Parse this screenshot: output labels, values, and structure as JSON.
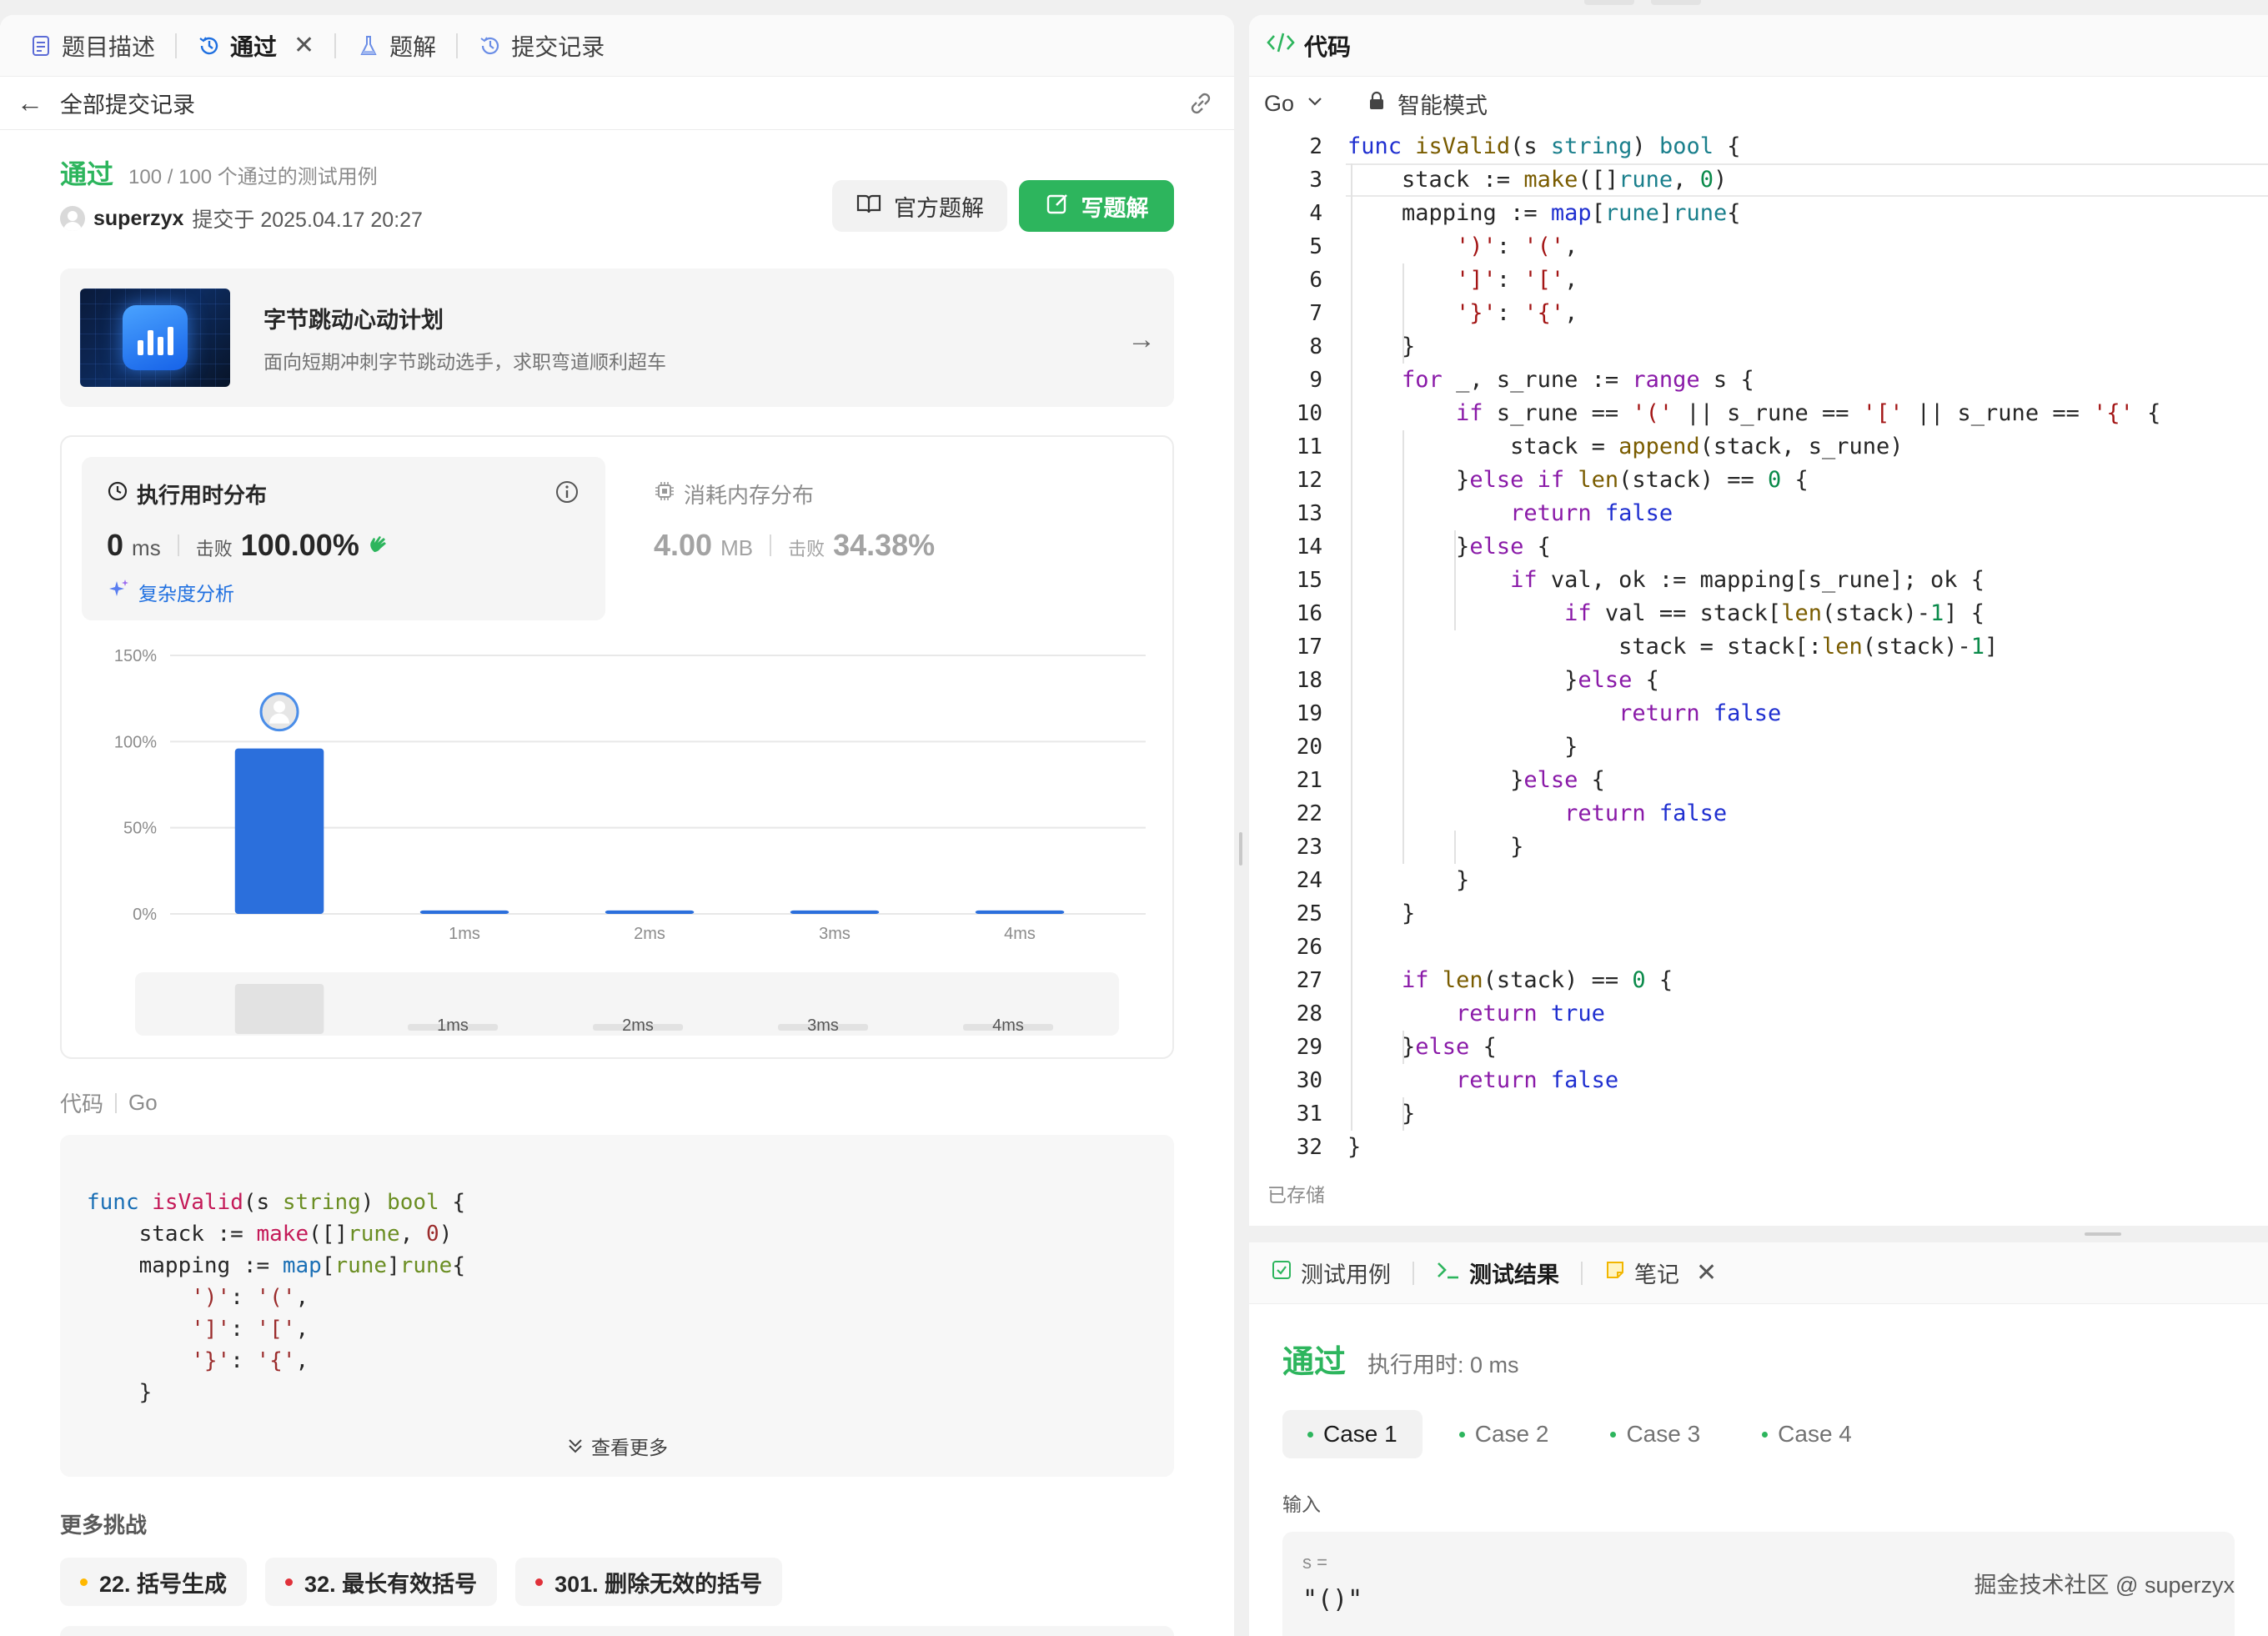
{
  "left_tabs": [
    {
      "label": "题目描述",
      "icon": "document-icon"
    },
    {
      "label": "通过",
      "icon": "history-icon"
    },
    {
      "label": "题解",
      "icon": "flask-icon"
    },
    {
      "label": "提交记录",
      "icon": "history-icon"
    }
  ],
  "subheader": {
    "back_label": "全部提交记录"
  },
  "submission": {
    "status": "通过",
    "cases": "100 / 100 个通过的测试用例",
    "user": "superzyx",
    "submitted": "提交于 2025.04.17 20:27",
    "official_button": "官方题解",
    "write_button": "写题解"
  },
  "promo": {
    "title": "字节跳动心动计划",
    "subtitle": "面向短期冲刺字节跳动选手，求职弯道顺利超车"
  },
  "runtime": {
    "title": "执行用时分布",
    "value": "0",
    "unit": "ms",
    "beat_label": "击败",
    "beat_value": "100.00%",
    "complexity_link": "复杂度分析"
  },
  "memory": {
    "title": "消耗内存分布",
    "value": "4.00",
    "unit": "MB",
    "beat_label": "击败",
    "beat_value": "34.38%"
  },
  "chart_data": {
    "type": "bar",
    "categories": [
      "",
      "1ms",
      "2ms",
      "3ms",
      "4ms"
    ],
    "values": [
      96,
      2,
      2,
      2,
      2
    ],
    "yticks": [
      "0%",
      "50%",
      "100%",
      "150%"
    ],
    "ylim": [
      0,
      150
    ],
    "highlight_index": 0,
    "bar_color": "#2b6fdc",
    "grid": true,
    "brush_labels": [
      "1ms",
      "2ms",
      "3ms",
      "4ms"
    ]
  },
  "code_section": {
    "label": "代码",
    "language": "Go",
    "preview_lines": [
      "func isValid(s string) bool {",
      "    stack := make([]rune, 0)",
      "    mapping := map[rune]rune{",
      "        ')': '(',",
      "        ']': '[',",
      "        '}': '{',",
      "    }"
    ],
    "view_more": "查看更多"
  },
  "more_challenges": {
    "title": "更多挑战",
    "items": [
      {
        "label": "22. 括号生成",
        "color": "#ffb800"
      },
      {
        "label": "32. 最长有效括号",
        "color": "#e0313a"
      },
      {
        "label": "301. 删除无效的括号",
        "color": "#e0313a"
      }
    ]
  },
  "code_panel": {
    "title": "代码",
    "language": "Go",
    "mode": "智能模式",
    "saved": "已存储",
    "line_numbers": [
      "2",
      "3",
      "4",
      "5",
      "6",
      "7",
      "8",
      "9",
      "10",
      "11",
      "12",
      "13",
      "14",
      "15",
      "16",
      "17",
      "18",
      "19",
      "20",
      "21",
      "22",
      "23",
      "24",
      "25",
      "26",
      "27",
      "28",
      "29",
      "30",
      "31",
      "32"
    ]
  },
  "test_tabs": [
    {
      "label": "测试用例",
      "icon": "checkbox-icon"
    },
    {
      "label": "测试结果",
      "icon": "terminal-icon"
    },
    {
      "label": "笔记",
      "icon": "note-icon"
    }
  ],
  "test_result": {
    "status": "通过",
    "time": "执行用时: 0 ms",
    "cases": [
      "Case 1",
      "Case 2",
      "Case 3",
      "Case 4"
    ],
    "input_label": "输入",
    "input_var": "s =",
    "input_value": "\"()\""
  },
  "watermark": "掘金技术社区 @ superzyx",
  "colors": {
    "accent_green": "#2db55d",
    "link_blue": "#1e6fe0",
    "bar_blue": "#2b6fdc"
  }
}
